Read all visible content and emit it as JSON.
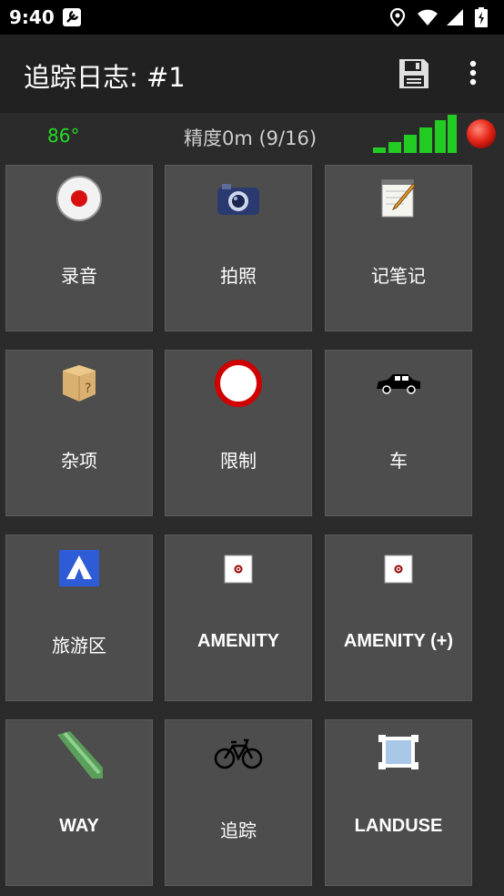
{
  "status": {
    "time": "9:40"
  },
  "appbar": {
    "title": "追踪日志: #1"
  },
  "info": {
    "bearing": "86°",
    "accuracy": "精度0m (9/16)"
  },
  "tiles": [
    {
      "label": "录音",
      "icon": "record-icon"
    },
    {
      "label": "拍照",
      "icon": "camera-icon"
    },
    {
      "label": "记笔记",
      "icon": "notepad-icon"
    },
    {
      "label": "杂项",
      "icon": "box-icon"
    },
    {
      "label": "限制",
      "icon": "no-entry-icon"
    },
    {
      "label": "车",
      "icon": "car-icon"
    },
    {
      "label": "旅游区",
      "icon": "campsite-icon"
    },
    {
      "label": "AMENITY",
      "icon": "poi-icon"
    },
    {
      "label": "AMENITY (+)",
      "icon": "poi-icon"
    },
    {
      "label": "WAY",
      "icon": "road-icon"
    },
    {
      "label": "追踪",
      "icon": "bicycle-icon"
    },
    {
      "label": "LANDUSE",
      "icon": "landuse-icon"
    }
  ],
  "colors": {
    "accent_green": "#22dd22",
    "tile_bg": "#4d4d4d",
    "appbar_bg": "#212121"
  }
}
